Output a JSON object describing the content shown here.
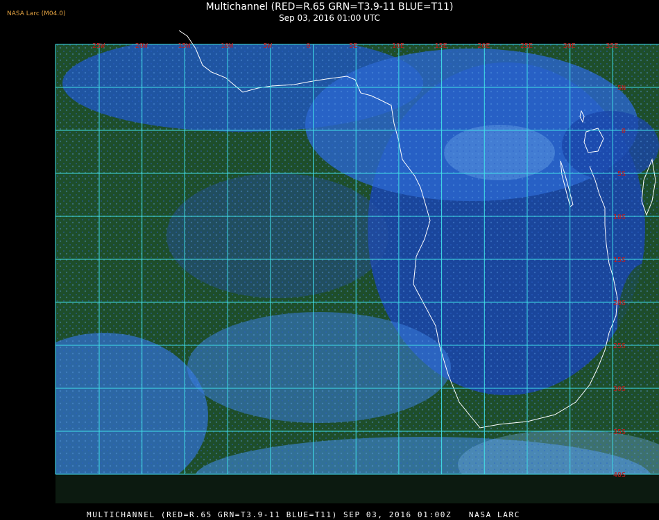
{
  "source_label": "NASA Larc (M04.0)",
  "title": "Multichannel (RED=R.65 GRN=T3.9-11 BLUE=T11)",
  "subtitle": "Sep 03, 2016 01:00 UTC",
  "footer": "MULTICHANNEL (RED=R.65 GRN=T3.9-11 BLUE=T11) SEP 03, 2016 01:00Z   NASA LARC",
  "longitude_labels": [
    "25W",
    "20W",
    "15W",
    "10W",
    "5W",
    "0",
    "5E",
    "10E",
    "15E",
    "20E",
    "25E",
    "30E",
    "35E"
  ],
  "latitude_labels": [
    "5N",
    "0",
    "5S",
    "10S",
    "15S",
    "20S",
    "25S",
    "30S",
    "35S",
    "40S"
  ],
  "colors": {
    "grid": "#40e0e8",
    "grid_label": "#c81818",
    "coastline": "#ffffff",
    "ocean_green": "#1e4e2a",
    "land_blue": "#1a46a8",
    "cloud_light": "#78b4ee",
    "background": "#000000"
  }
}
